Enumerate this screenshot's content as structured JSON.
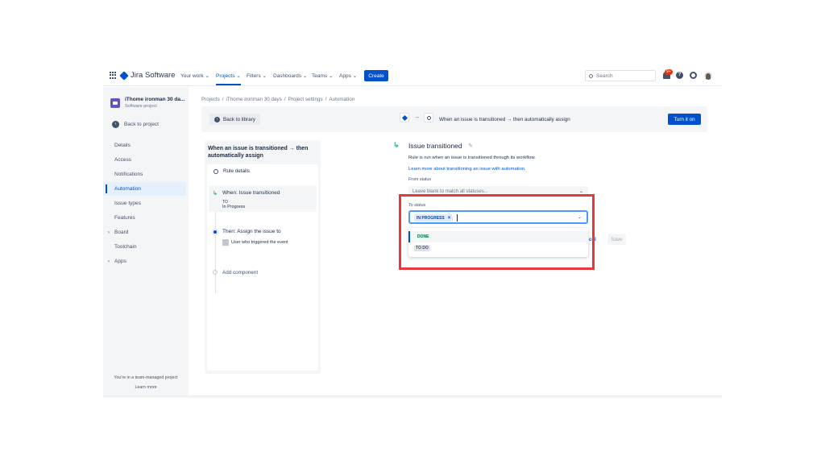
{
  "nav": {
    "logo_text": "Jira Software",
    "items": [
      {
        "label": "Your work ⌄",
        "active": false
      },
      {
        "label": "Projects ⌄",
        "active": true
      },
      {
        "label": "Filters ⌄",
        "active": false
      },
      {
        "label": "Dashboards ⌄",
        "active": false
      },
      {
        "label": "Teams ⌄",
        "active": false
      },
      {
        "label": "Apps ⌄",
        "active": false
      }
    ],
    "create_label": "Create",
    "search_placeholder": "Search",
    "notification_badge": "9+",
    "help_glyph": "?"
  },
  "sidebar": {
    "project_name": "iThome ironman 30 da...",
    "project_type": "Software project",
    "back_label": "Back to project",
    "items": [
      {
        "label": "Details",
        "active": false,
        "expandable": false
      },
      {
        "label": "Access",
        "active": false,
        "expandable": false
      },
      {
        "label": "Notifications",
        "active": false,
        "expandable": false
      },
      {
        "label": "Automation",
        "active": true,
        "expandable": false
      },
      {
        "label": "Issue types",
        "active": false,
        "expandable": false
      },
      {
        "label": "Features",
        "active": false,
        "expandable": false
      },
      {
        "label": "Board",
        "active": false,
        "expandable": true
      },
      {
        "label": "Toolchain",
        "active": false,
        "expandable": false
      },
      {
        "label": "Apps",
        "active": false,
        "expandable": true
      }
    ],
    "footer_text": "You're in a team-managed project",
    "footer_link": "Learn more"
  },
  "breadcrumb": [
    "Projects",
    "iThome ironman 30 days",
    "Project settings",
    "Automation"
  ],
  "strip": {
    "back_library": "Back to library",
    "arrow": "→",
    "rule_summary": "When an issue is transitioned → then automatically assign",
    "turn_on": "Turn it on"
  },
  "rule": {
    "title": "When an issue is transitioned → then automatically assign",
    "details_label": "Rule details",
    "when_title": "When: Issue transitioned",
    "when_to": "TO",
    "when_status": "In Progress",
    "then_title": "Then: Assign the issue to",
    "then_user": "User who triggered the event",
    "add_component": "Add component"
  },
  "config": {
    "title": "Issue transitioned",
    "description": "Rule is run when an issue is transitioned through its workflow.",
    "learn_more": "Learn more about transitioning an issue with automation.",
    "from_label": "From status",
    "from_placeholder": "Leave blank to match all statuses...",
    "to_label": "To status",
    "to_selected": "IN PROGRESS",
    "remove_glyph": "×",
    "chevron": "⌄",
    "options": [
      "DONE",
      "TO DO"
    ],
    "cancel_partial": "cel",
    "save_label": "Save"
  },
  "colors": {
    "brand_blue": "#0052cc",
    "highlight_red": "#e5383b",
    "done_green": "#006644"
  }
}
